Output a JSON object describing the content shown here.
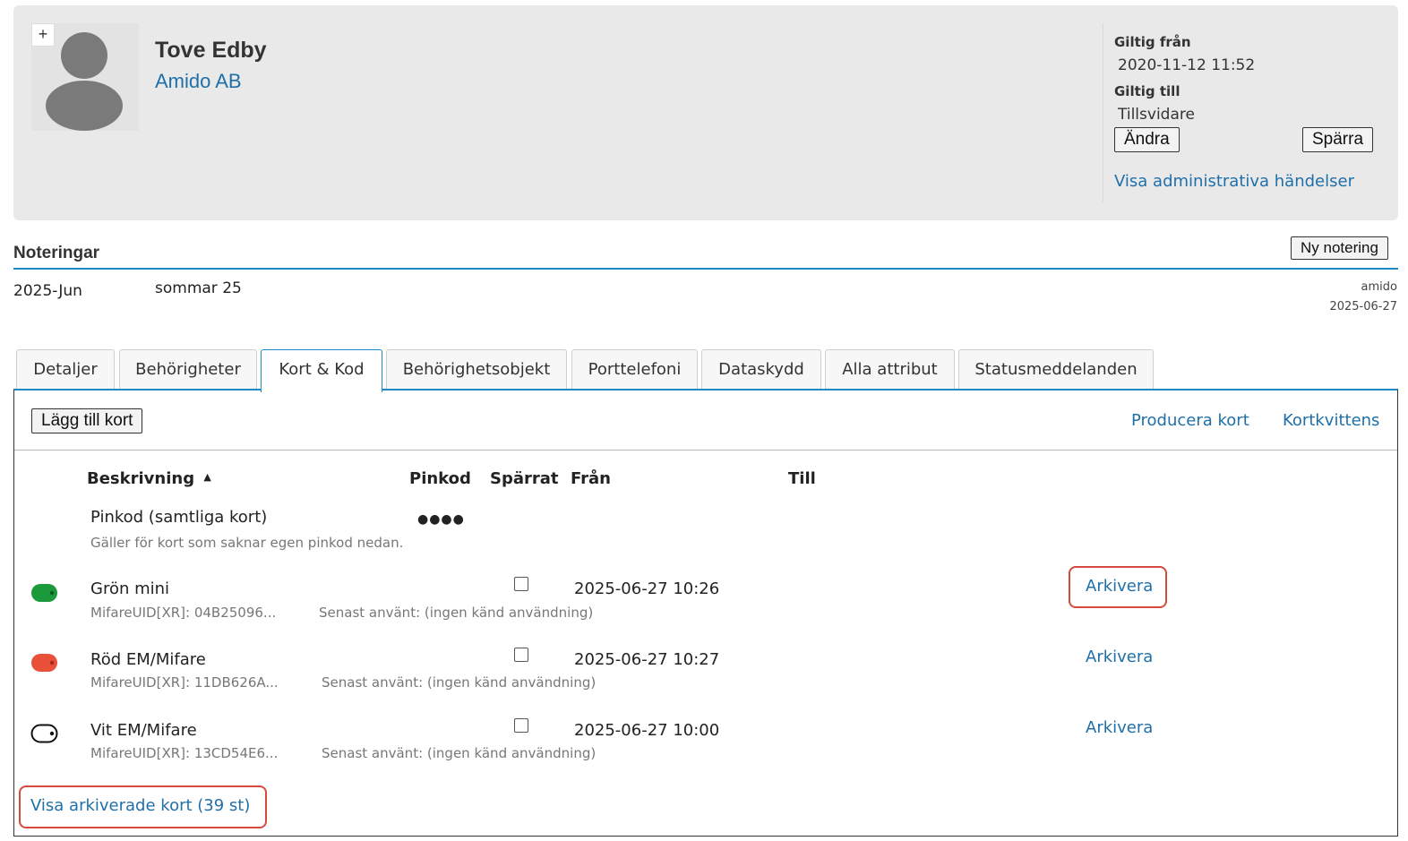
{
  "header": {
    "plus_label": "+",
    "name": "Tove Edby",
    "company": "Amido AB",
    "valid_from_label": "Giltig från",
    "valid_from_value": "2020-11-12 11:52",
    "valid_to_label": "Giltig till",
    "valid_to_value": "Tillsvidare",
    "change_button": "Ändra",
    "block_button": "Spärra",
    "admin_events_link": "Visa administrativa händelser"
  },
  "notes": {
    "title": "Noteringar",
    "new_button": "Ny notering",
    "items": [
      {
        "date": "2025-Jun",
        "text": "sommar 25",
        "author": "amido",
        "created": "2025-06-27"
      }
    ]
  },
  "tabs": [
    {
      "label": "Detaljer"
    },
    {
      "label": "Behörigheter"
    },
    {
      "label": "Kort & Kod"
    },
    {
      "label": "Behörighetsobjekt"
    },
    {
      "label": "Porttelefoni"
    },
    {
      "label": "Dataskydd"
    },
    {
      "label": "Alla attribut"
    },
    {
      "label": "Statusmeddelanden"
    }
  ],
  "cards_panel": {
    "add_card_button": "Lägg till kort",
    "produce_card_link": "Producera kort",
    "card_receipt_link": "Kortkvittens",
    "columns": {
      "description": "Beskrivning",
      "sort_indicator": "▲",
      "pincode": "Pinkod",
      "blocked": "Spärrat",
      "from": "Från",
      "to": "Till"
    },
    "pin_row": {
      "title": "Pinkod (samtliga kort)",
      "value": "●●●●",
      "note": "Gäller för kort som saknar egen pinkod nedan."
    },
    "cards": [
      {
        "name": "Grön mini",
        "uid": "MifareUID[XR]: 04B25096...",
        "last_used": "Senast använt: (ingen känd användning)",
        "from": "2025-06-27 10:26",
        "action": "Arkivera",
        "color": "#1a9a3a",
        "icon": "green-tag-icon"
      },
      {
        "name": "Röd EM/Mifare",
        "uid": "MifareUID[XR]: 11DB626A...",
        "last_used": "Senast använt: (ingen känd användning)",
        "from": "2025-06-27 10:27",
        "action": "Arkivera",
        "color": "#e8503a",
        "icon": "red-tag-icon"
      },
      {
        "name": "Vit EM/Mifare",
        "uid": "MifareUID[XR]: 13CD54E6...",
        "last_used": "Senast använt: (ingen känd användning)",
        "from": "2025-06-27 10:00",
        "action": "Arkivera",
        "color": "#ffffff",
        "icon": "white-tag-icon"
      }
    ],
    "show_archived_link": "Visa arkiverade kort (39 st)"
  },
  "colors": {
    "accent": "#1f8ac6",
    "link": "#1f6fa8",
    "highlight": "#d64a3e"
  }
}
